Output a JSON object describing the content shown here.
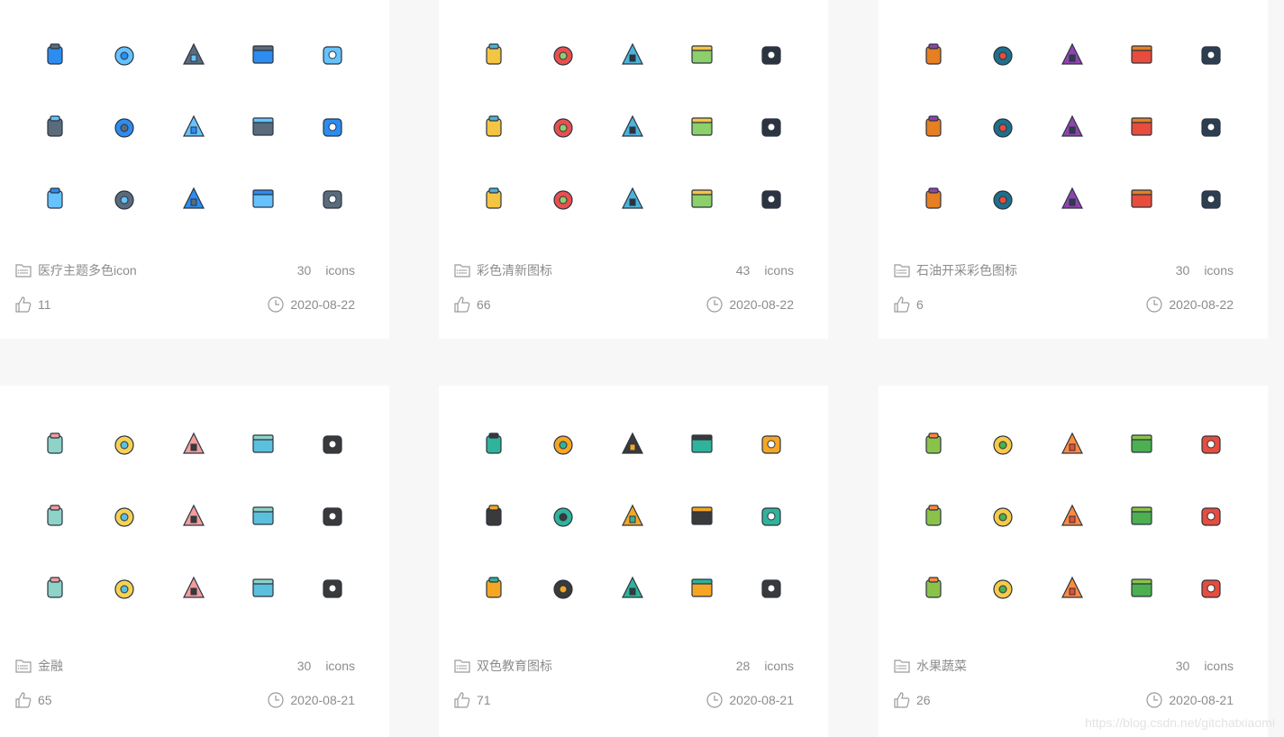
{
  "cards": [
    {
      "title": "医疗主题多色icon",
      "count": "30",
      "count_label": "icons",
      "likes": "11",
      "date": "2020-08-22",
      "icons": [
        "toilet-paper-icon",
        "flask-stand-icon",
        "clipboard-icon",
        "ambulance-icon",
        "skull-icon",
        "medicine-bottle-icon",
        "face-mask-icon",
        "bandage-icon",
        "syringe-icon",
        "bone-xray-icon",
        "eye-chart-icon",
        "doctor-icon",
        "molecule-icon",
        "pill-bottle-icon",
        "first-aid-kit-icon"
      ]
    },
    {
      "title": "彩色清新图标",
      "count": "43",
      "count_label": "icons",
      "likes": "66",
      "date": "2020-08-22",
      "icons": [
        "lightbulb-icon",
        "flask-icon",
        "magnifier-icon",
        "calendar-icon",
        "briefcase-icon",
        "pencil-icon",
        "ruler-icon",
        "document-icon",
        "laptop-icon",
        "book-icon",
        "graduation-cap-icon",
        "alarm-clock-icon",
        "football-icon",
        "pencil-icon",
        "basketball-icon"
      ]
    },
    {
      "title": "石油开采彩色图标",
      "count": "30",
      "count_label": "icons",
      "likes": "6",
      "date": "2020-08-22",
      "icons": [
        "oil-drop-bowl-icon",
        "oil-tank-icon",
        "fuel-pump-icon",
        "oil-derrick-icon",
        "tanker-ship-icon",
        "oil-tap-icon",
        "tank-truck-icon",
        "oil-drops-icon",
        "fuel-can-icon",
        "oil-barrels-icon",
        "oil-jug-icon",
        "oil-trailer-icon",
        "oil-refinery-icon",
        "jerry-can-icon",
        "oil-canister-icon"
      ]
    },
    {
      "title": "金融",
      "count": "30",
      "count_label": "icons",
      "likes": "65",
      "date": "2020-08-21",
      "icons": [
        "money-bag-icon",
        "lightbulb-coin-icon",
        "coin-cycle-icon",
        "gold-bars-icon",
        "coin-bucket-icon",
        "happy-wallet-icon",
        "hand-coin-icon",
        "wallet-icon",
        "sad-wallet-icon",
        "cash-receipt-icon",
        "mobile-pay-icon",
        "ledger-book-icon",
        "atm-icon",
        "bar-chart-icon",
        "bill-icon"
      ]
    },
    {
      "title": "双色教育图标",
      "count": "28",
      "count_label": "icons",
      "likes": "71",
      "date": "2020-08-21",
      "icons": [
        "phone-book-icon",
        "pencils-icon",
        "books-stack-icon",
        "test-tubes-icon",
        "alarm-clock-icon",
        "binders-icon",
        "calendar-05-icon",
        "lightbulb-icon",
        "backpack-icon",
        "school-building-icon",
        "pencil-icon",
        "ruler-pen-icon",
        "protractor-icon",
        "magnifier-icon",
        "globe-icon"
      ]
    },
    {
      "title": "水果蔬菜",
      "count": "30",
      "count_label": "icons",
      "likes": "26",
      "date": "2020-08-21",
      "icons": [
        "artichoke-icon",
        "coconut-icon",
        "potato-icon",
        "apple-icon",
        "pear-icon",
        "lemon-icon",
        "carrot-icon",
        "lemon-slice-icon",
        "pumpkin-icon",
        "leek-icon",
        "watermelon-lemon-icon",
        "onion-ring-icon",
        "watermelon-icon",
        "mushroom-icon",
        "orange-icon"
      ]
    }
  ],
  "watermark": "https://blog.csdn.net/gitchatxiaomi"
}
